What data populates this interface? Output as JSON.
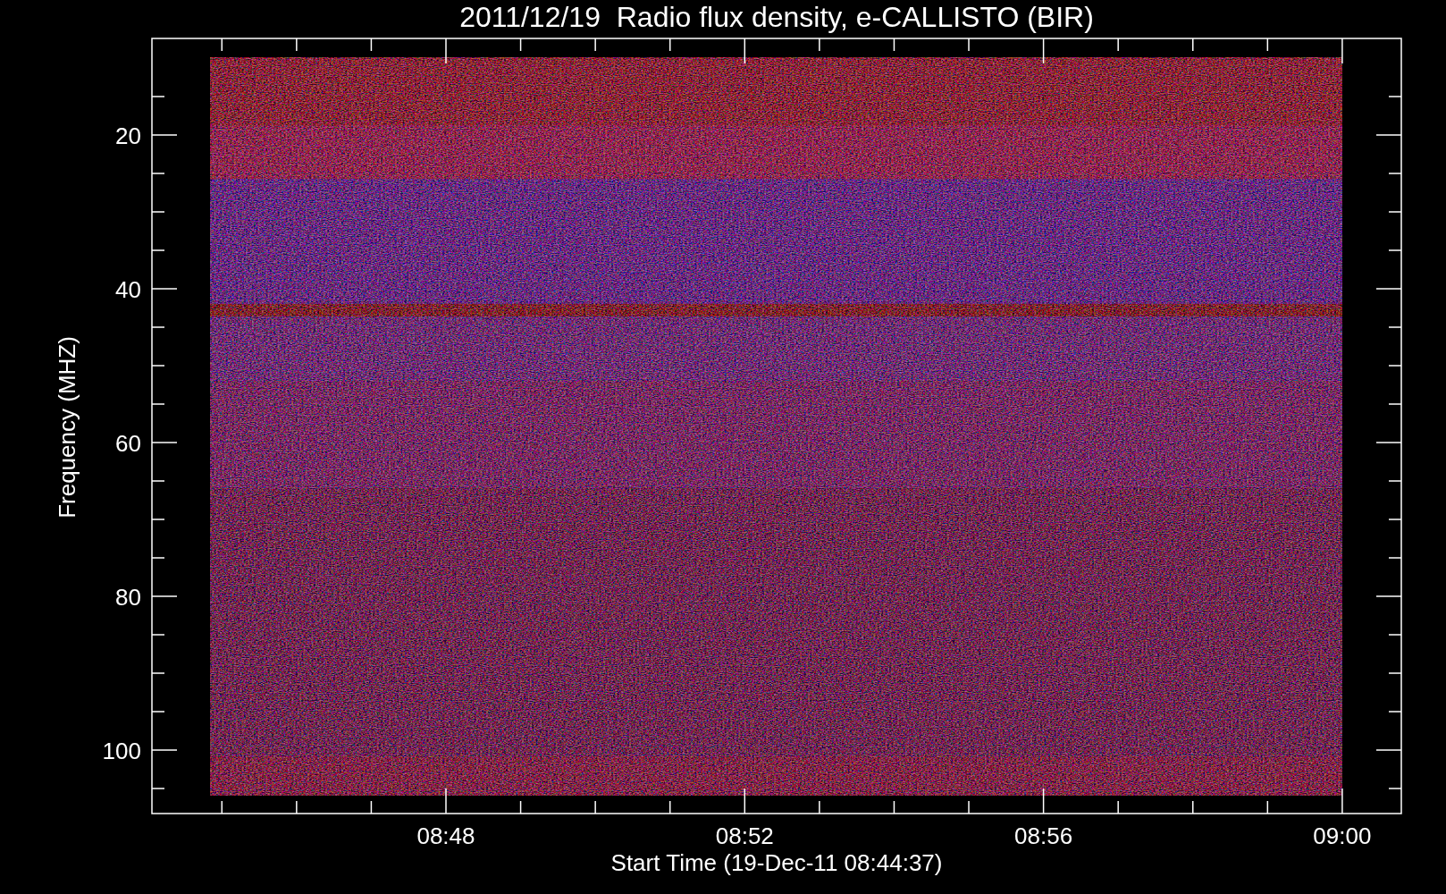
{
  "plot": {
    "title": "2011/12/19  Radio flux density, e-CALLISTO (BIR)",
    "xlabel": "Start Time (19-Dec-11 08:44:37)",
    "ylabel": "Frequency (MHZ)",
    "xtick_labels": [
      "08:48",
      "08:52",
      "08:56",
      "09:00"
    ],
    "ytick_labels": [
      "20",
      "40",
      "60",
      "80",
      "100"
    ]
  }
}
